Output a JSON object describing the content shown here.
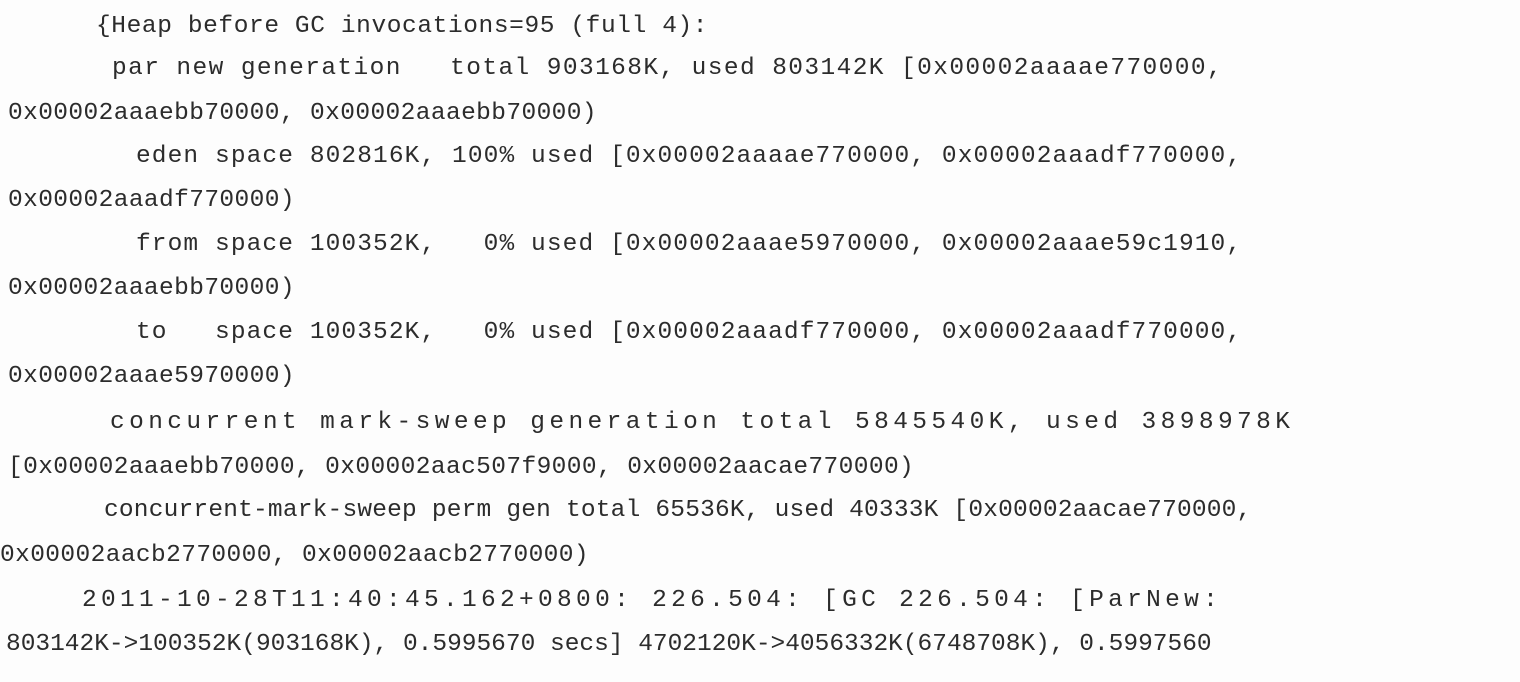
{
  "document": {
    "lines": [
      "{Heap before GC invocations=95 (full 4):",
      "par new generation   total 903168K, used 803142K [0x00002aaaae770000,",
      "0x00002aaaebb70000, 0x00002aaaebb70000)",
      "eden space 802816K, 100% used [0x00002aaaae770000, 0x00002aaadf770000,",
      "0x00002aaadf770000)",
      "from space 100352K,   0% used [0x00002aaae5970000, 0x00002aaae59c1910,",
      "0x00002aaaebb70000)",
      "to   space 100352K,   0% used [0x00002aaadf770000, 0x00002aaadf770000,",
      "0x00002aaae5970000)",
      "concurrent mark-sweep generation total 5845540K, used 3898978K",
      "[0x00002aaaebb70000, 0x00002aac507f9000, 0x00002aacae770000)",
      "concurrent-mark-sweep perm gen total 65536K, used 40333K [0x00002aacae770000,",
      "0x00002aacb2770000, 0x00002aacb2770000)",
      "2011-10-28T11:40:45.162+0800: 226.504: [GC 226.504: [ParNew:",
      "803142K->100352K(903168K), 0.5995670 secs] 4702120K->4056332K(6748708K), 0.5997560"
    ]
  }
}
